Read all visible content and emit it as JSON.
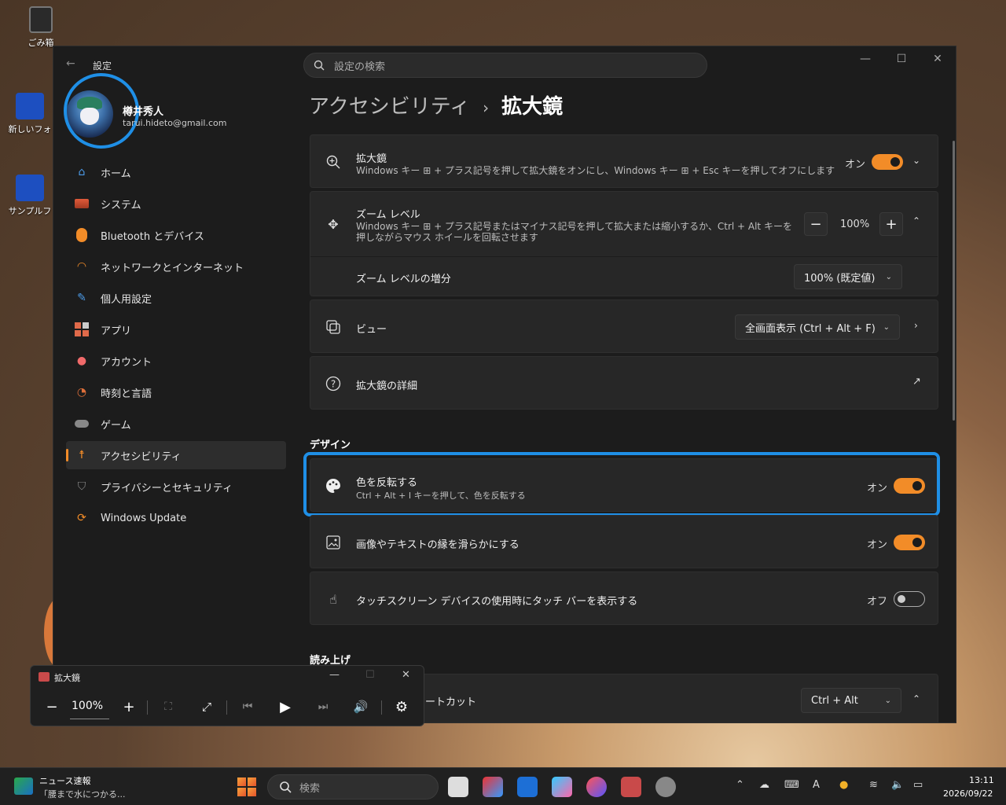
{
  "desktop": {
    "icons": [
      {
        "label": "ごみ箱",
        "icon": "recycle-bin-icon"
      },
      {
        "label": "新しいフォ",
        "icon": "folder-icon"
      },
      {
        "label": "サンプルフ",
        "icon": "folder-icon"
      }
    ]
  },
  "window": {
    "app_title": "設定",
    "controls": {
      "minimize": "—",
      "maximize": "☐",
      "close": "✕"
    },
    "search_placeholder": "設定の検索"
  },
  "user": {
    "name": "樽井秀人",
    "email": "tarui.hideto@gmail.com"
  },
  "nav": {
    "items": [
      {
        "label": "ホーム",
        "icon": "home-icon",
        "color": "#4c9be8"
      },
      {
        "label": "システム",
        "icon": "system-icon",
        "color": "#e05a3a"
      },
      {
        "label": "Bluetooth とデバイス",
        "icon": "bluetooth-icon",
        "color": "#f28c28"
      },
      {
        "label": "ネットワークとインターネット",
        "icon": "wifi-icon",
        "color": "#f28c28"
      },
      {
        "label": "個人用設定",
        "icon": "brush-icon",
        "color": "#4c9be8"
      },
      {
        "label": "アプリ",
        "icon": "apps-icon",
        "color": "#e06a4a"
      },
      {
        "label": "アカウント",
        "icon": "account-icon",
        "color": "#f06a6a"
      },
      {
        "label": "時刻と言語",
        "icon": "clock-globe-icon",
        "color": "#e0703a"
      },
      {
        "label": "ゲーム",
        "icon": "gamepad-icon",
        "color": "#888888"
      },
      {
        "label": "アクセシビリティ",
        "icon": "accessibility-icon",
        "color": "#f28c28"
      },
      {
        "label": "プライバシーとセキュリティ",
        "icon": "shield-icon",
        "color": "#888888"
      },
      {
        "label": "Windows Update",
        "icon": "update-icon",
        "color": "#f28c28"
      }
    ],
    "active_index": 9
  },
  "breadcrumb": {
    "parent": "アクセシビリティ",
    "separator": "›",
    "current": "拡大鏡"
  },
  "magnifier_card": {
    "title": "拡大鏡",
    "subtitle": "Windows キー ⊞ + プラス記号を押して拡大鏡をオンにし、Windows キー ⊞ + Esc キーを押してオフにします",
    "state": "オン"
  },
  "zoom_card": {
    "title": "ズーム レベル",
    "subtitle_line1": "Windows キー ⊞ + プラス記号またはマイナス記号を押して拡大または縮小するか、Ctrl + Alt キーを",
    "subtitle_line2": "押しながらマウス ホイールを回転させます",
    "minus": "−",
    "value": "100%",
    "plus": "+",
    "increment_label": "ズーム レベルの増分",
    "increment_value": "100% (既定値)"
  },
  "view_card": {
    "title": "ビュー",
    "value": "全画面表示 (Ctrl + Alt + F)"
  },
  "details_card": {
    "title": "拡大鏡の詳細"
  },
  "design_section": {
    "title": "デザイン",
    "invert": {
      "title": "色を反転する",
      "subtitle": "Ctrl + Alt + I キーを押して、色を反転する",
      "state": "オン"
    },
    "smooth": {
      "title": "画像やテキストの縁を滑らかにする",
      "state": "オン"
    },
    "touch": {
      "title": "タッチスクリーン デバイスの使用時にタッチ バーを表示する",
      "state": "オフ"
    }
  },
  "reading_section": {
    "title": "読み上げ",
    "shortcut_title": "ートカット",
    "shortcut_value": "Ctrl + Alt"
  },
  "magnifier_toolbar": {
    "title": "拡大鏡",
    "zoom": "100%",
    "minus": "−",
    "plus": "+"
  },
  "taskbar": {
    "news_title": "ニュース速報",
    "news_sub": "「腰まで水につかる...",
    "search_placeholder": "検索",
    "ime": "A",
    "time": "13:11",
    "date": "2026/09/22"
  },
  "colors": {
    "accent": "#f28c28",
    "highlight": "#1f8fe6",
    "window_bg": "#1c1c1c",
    "card_bg": "#272727"
  }
}
